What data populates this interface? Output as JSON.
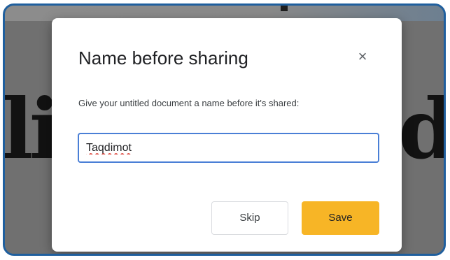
{
  "background": {
    "left_text": "li",
    "right_text": "d",
    "backdrop_color": "#707070"
  },
  "dialog": {
    "title": "Name before sharing",
    "close_icon": "×",
    "description": "Give your untitled document a name before it's shared:",
    "input_value": "Taqdimot",
    "skip_label": "Skip",
    "save_label": "Save",
    "accent_color": "#f7b526",
    "input_border_color": "#4a7fd6"
  }
}
